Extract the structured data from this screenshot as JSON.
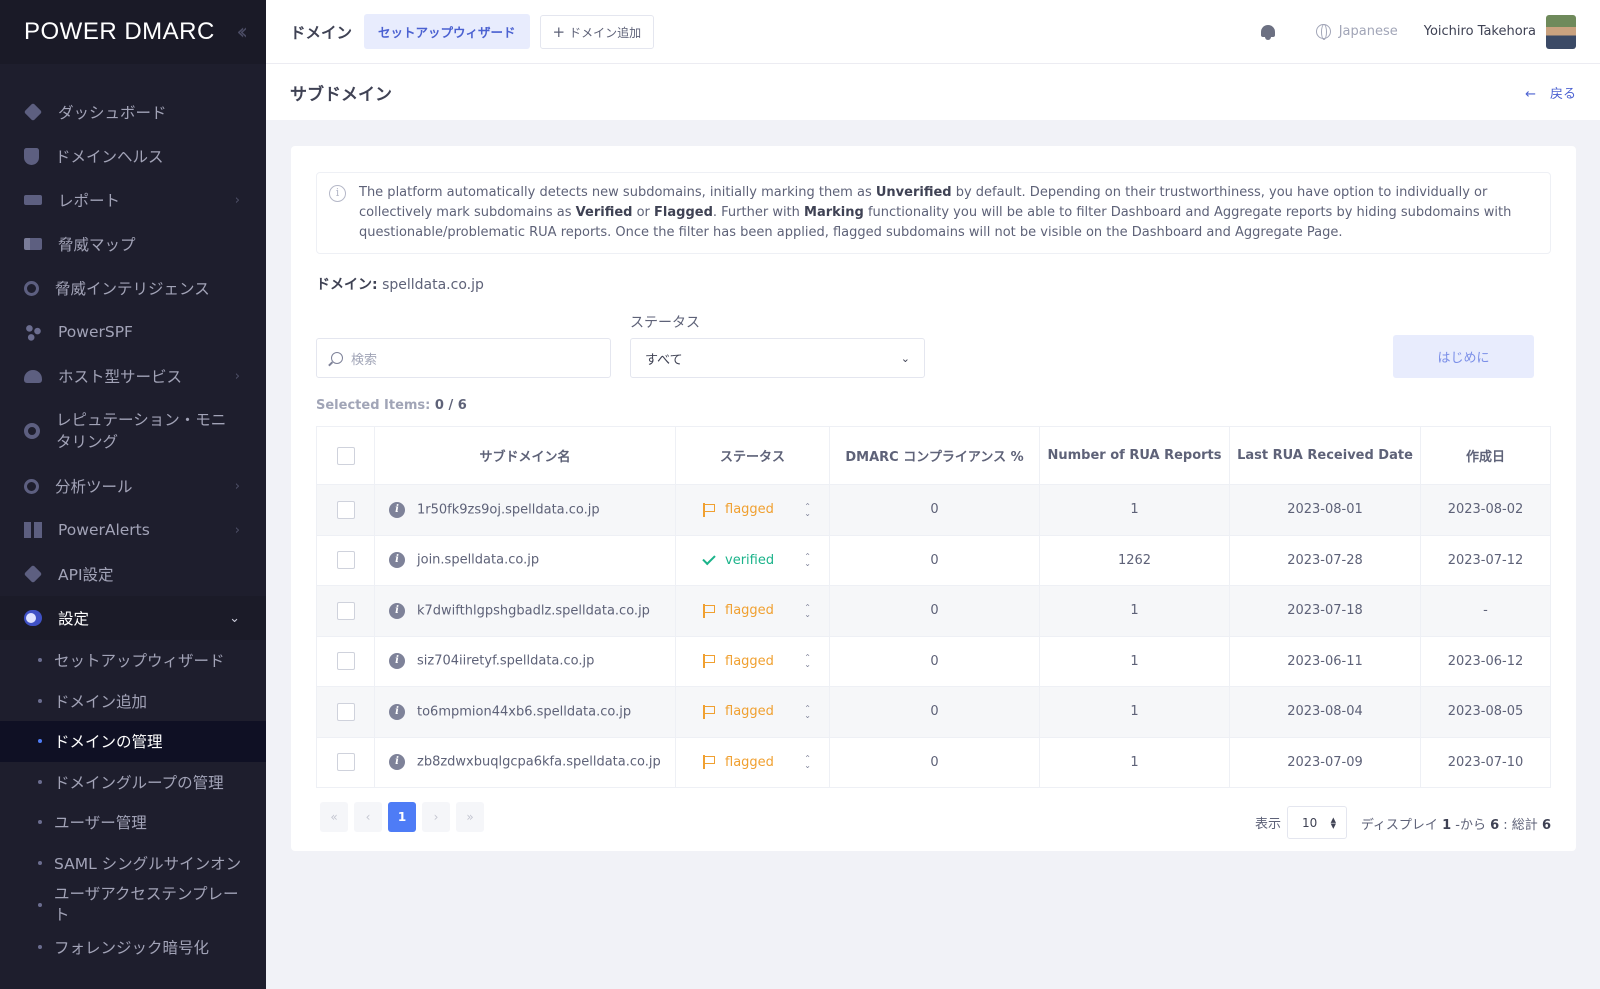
{
  "brand": {
    "logo": "POWER DMARC"
  },
  "sidebar": {
    "items": [
      {
        "label": "ダッシュボード",
        "icon": "dashboard-icon"
      },
      {
        "label": "ドメインヘルス",
        "icon": "shield-icon"
      },
      {
        "label": "レポート",
        "icon": "report-icon"
      },
      {
        "label": "脅威マップ",
        "icon": "map-icon"
      },
      {
        "label": "脅威インテリジェンス",
        "icon": "radar-icon"
      },
      {
        "label": "PowerSPF",
        "icon": "spf-icon"
      },
      {
        "label": "ホスト型サービス",
        "icon": "cloud-icon"
      },
      {
        "label": "レピュテーション・モニタリング",
        "icon": "target-icon"
      },
      {
        "label": "分析ツール",
        "icon": "tools-icon"
      },
      {
        "label": "PowerAlerts",
        "icon": "alerts-icon"
      },
      {
        "label": "API設定",
        "icon": "api-icon"
      },
      {
        "label": "設定",
        "icon": "toggle-icon"
      }
    ],
    "settings_sub": [
      "セットアップウィザード",
      "ドメイン追加",
      "ドメインの管理",
      "ドメイングループの管理",
      "ユーザー管理",
      "SAML シングルサインオン",
      "ユーザアクセステンプレート",
      "フォレンジック暗号化"
    ]
  },
  "header": {
    "title": "ドメイン",
    "wizard_btn": "セットアップウィザード",
    "add_btn": "ドメイン追加",
    "language": "Japanese",
    "user": "Yoichiro Takehora"
  },
  "page": {
    "title": "サブドメイン",
    "back": "戻る"
  },
  "info": {
    "p1": "The platform automatically detects new subdomains, initially marking them as ",
    "b1": "Unverified",
    "p2": " by default. Depending on their trustworthiness, you have option to individually or collectively mark subdomains as ",
    "b2": "Verified",
    "p3": " or ",
    "b3": "Flagged",
    "p4": ". Further with ",
    "b4": "Marking",
    "p5": " functionality you will be able to filter Dashboard and Aggregate reports by hiding subdomains with questionable/problematic RUA reports. Once the filter has been applied, flagged subdomains will not be visible on the Dashboard and Aggregate Page."
  },
  "domain": {
    "label": "ドメイン:",
    "value": "spelldata.co.jp"
  },
  "filters": {
    "search_placeholder": "検索",
    "status_label": "ステータス",
    "status_value": "すべて",
    "reset_btn": "はじめに"
  },
  "selected": {
    "label": "Selected Items:",
    "value": "0 / 6"
  },
  "table": {
    "headers": [
      "サブドメイン名",
      "ステータス",
      "DMARC コンプライアンス %",
      "Number of RUA Reports",
      "Last RUA Received Date",
      "作成日"
    ],
    "rows": [
      {
        "name": "1r50fk9zs9oj.spelldata.co.jp",
        "status": "flagged",
        "compliance": "0",
        "rua": "1",
        "last": "2023-08-01",
        "created": "2023-08-02"
      },
      {
        "name": "join.spelldata.co.jp",
        "status": "verified",
        "compliance": "0",
        "rua": "1262",
        "last": "2023-07-28",
        "created": "2023-07-12"
      },
      {
        "name": "k7dwifthlgpshgbadlz.spelldata.co.jp",
        "status": "flagged",
        "compliance": "0",
        "rua": "1",
        "last": "2023-07-18",
        "created": "-"
      },
      {
        "name": "siz704iiretyf.spelldata.co.jp",
        "status": "flagged",
        "compliance": "0",
        "rua": "1",
        "last": "2023-06-11",
        "created": "2023-06-12"
      },
      {
        "name": "to6mpmion44xb6.spelldata.co.jp",
        "status": "flagged",
        "compliance": "0",
        "rua": "1",
        "last": "2023-08-04",
        "created": "2023-08-05"
      },
      {
        "name": "zb8zdwxbuqlgcpa6kfa.spelldata.co.jp",
        "status": "flagged",
        "compliance": "0",
        "rua": "1",
        "last": "2023-07-09",
        "created": "2023-07-10"
      }
    ]
  },
  "pagination": {
    "first": "«",
    "prev": "‹",
    "page": "1",
    "next": "›",
    "last": "»",
    "show_label": "表示",
    "per_page": "10",
    "display_prefix": "ディスプレイ",
    "from": "1",
    "from_label": "-から",
    "to": "6",
    "total_label": ": 総計",
    "total": "6"
  },
  "colors": {
    "accent": "#4e7cf6",
    "flagged": "#f0a030",
    "verified": "#1bb38a",
    "sidebar": "#1e1e2d"
  }
}
